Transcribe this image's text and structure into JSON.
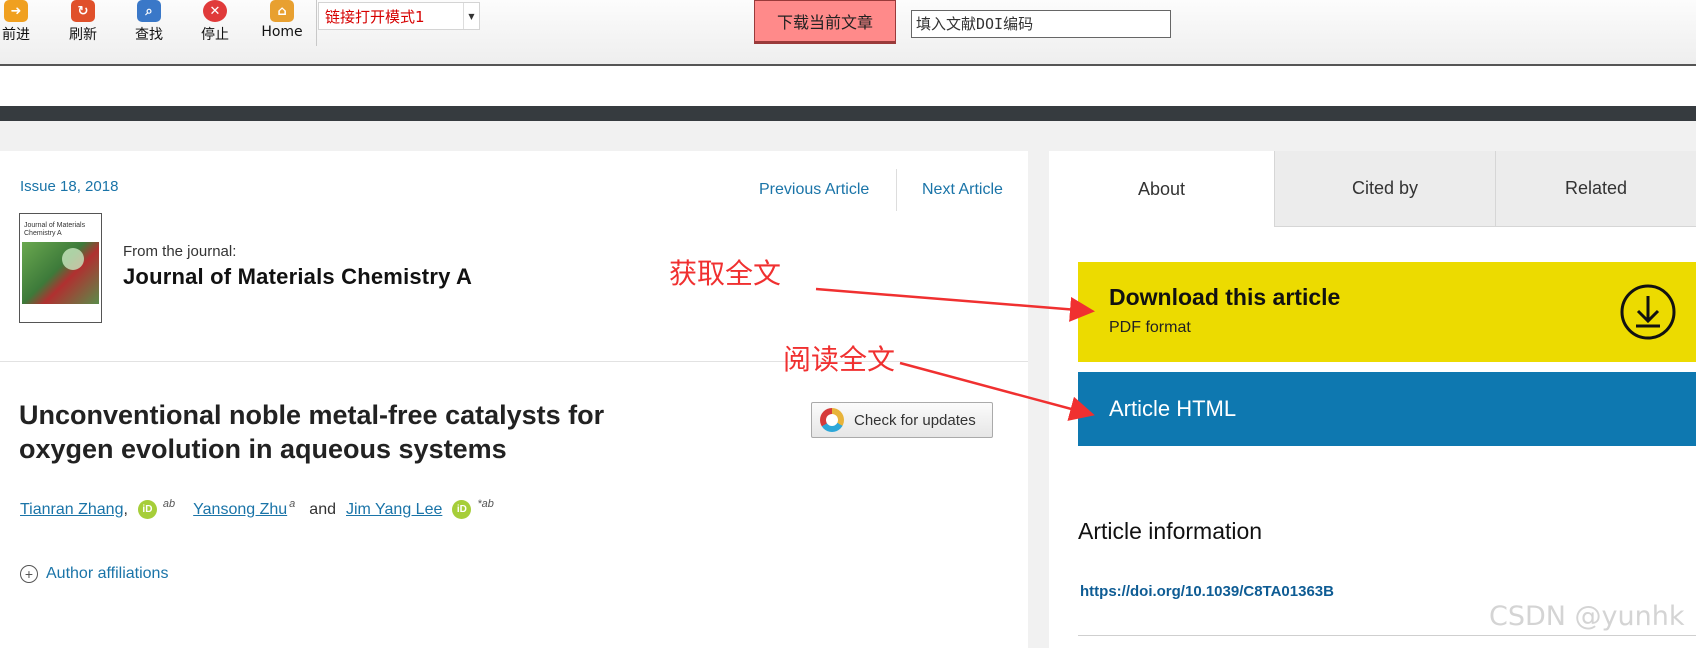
{
  "toolbar": {
    "buttons": [
      {
        "label": "前进",
        "icon": "forward-icon",
        "color": "#f0a020"
      },
      {
        "label": "刷新",
        "icon": "refresh-icon",
        "color": "#e0502a"
      },
      {
        "label": "查找",
        "icon": "search-icon",
        "color": "#3a78c8"
      },
      {
        "label": "停止",
        "icon": "stop-icon",
        "color": "#e03a3a"
      },
      {
        "label": "Home",
        "icon": "home-icon",
        "color": "#e8a030"
      }
    ],
    "mode_select": "链接打开模式1",
    "download_current": "下载当前文章",
    "doi_placeholder": "填入文献DOI编码"
  },
  "article": {
    "issue": "Issue 18, 2018",
    "prev": "Previous Article",
    "next": "Next Article",
    "cover_title": "Journal of Materials Chemistry A",
    "from_journal": "From the journal:",
    "journal": "Journal of Materials Chemistry A",
    "title_line1": "Unconventional noble metal-free catalysts for",
    "title_line2": "oxygen evolution in aqueous systems",
    "check_updates": "Check for updates",
    "authors": [
      {
        "name": "Tianran Zhang",
        "sup": "ab",
        "orcid": true
      },
      {
        "name": "Yansong Zhu",
        "sup": "a",
        "orcid": false
      },
      {
        "name": "Jim Yang Lee",
        "sup": "*ab",
        "orcid": true
      }
    ],
    "and_word": "and",
    "orcid_label": "iD",
    "affiliations": "Author affiliations"
  },
  "sidebar": {
    "tabs": [
      "About",
      "Cited by",
      "Related"
    ],
    "download_title": "Download this article",
    "download_sub": "PDF format",
    "html_title": "Article HTML",
    "info_title": "Article information",
    "doi": "https://doi.org/10.1039/C8TA01363B",
    "colors": {
      "download": "#ecdb00",
      "html": "#0e78b0"
    }
  },
  "annotations": {
    "get_fulltext": "获取全文",
    "read_fulltext": "阅读全文",
    "color": "#f03030"
  },
  "watermark": "CSDN @yunhk"
}
